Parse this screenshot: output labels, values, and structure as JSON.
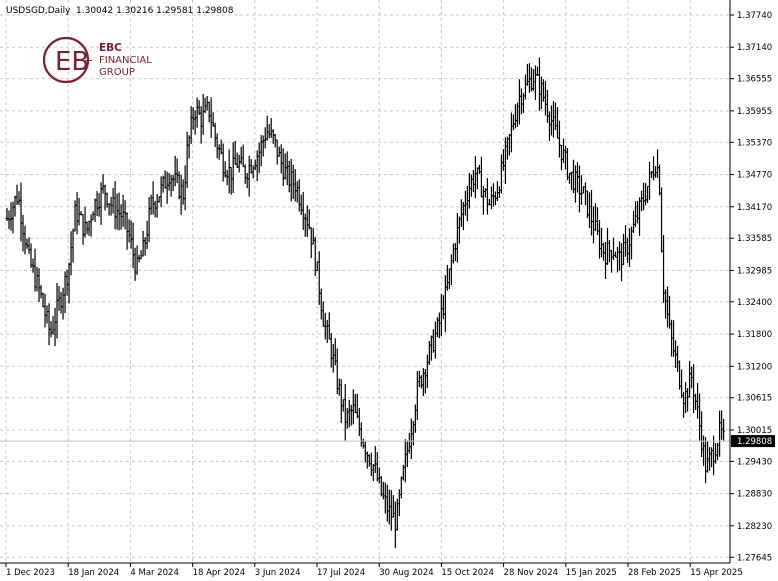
{
  "header": {
    "symbol": "USDSGD,Daily",
    "ohlc": "1.30042 1.30216 1.29581 1.29808"
  },
  "logo": {
    "mark": "EB",
    "line1": "EBC",
    "line2": "FINANCIAL",
    "line3": "GROUP"
  },
  "colors": {
    "bars": "#000000",
    "grid": "#c8c8c8",
    "price_line": "#c0c0c0",
    "price_label_bg": "#000000",
    "price_label_text": "#ffffff",
    "logo": "#7a2230"
  },
  "chart_data": {
    "type": "ohlc",
    "symbol": "USDSGD",
    "timeframe": "Daily",
    "last_price": "1.29808",
    "ylim": [
      1.2765,
      1.3774
    ],
    "y_ticks": [
      "1.37740",
      "1.37140",
      "1.36555",
      "1.35955",
      "1.35370",
      "1.34770",
      "1.34170",
      "1.33585",
      "1.32985",
      "1.32400",
      "1.31800",
      "1.31200",
      "1.30615",
      "1.30015",
      "1.29430",
      "1.28830",
      "1.28230",
      "1.27645"
    ],
    "x_ticks": [
      "1 Dec 2023",
      "18 Jan 2024",
      "4 Mar 2024",
      "18 Apr 2024",
      "3 Jun 2024",
      "17 Jul 2024",
      "30 Aug 2024",
      "15 Oct 2024",
      "28 Nov 2024",
      "15 Jan 2025",
      "28 Feb 2025",
      "15 Apr 2025"
    ],
    "grid": true,
    "series": [
      {
        "close_path": [
          [
            0,
            1.3395
          ],
          [
            3,
            1.344
          ],
          [
            6,
            1.332
          ],
          [
            9,
            1.326
          ],
          [
            12,
            1.318
          ],
          [
            15,
            1.325
          ],
          [
            17,
            1.33
          ],
          [
            19,
            1.341
          ],
          [
            22,
            1.337
          ],
          [
            24,
            1.342
          ],
          [
            27,
            1.345
          ],
          [
            29,
            1.342
          ],
          [
            32,
            1.34
          ],
          [
            34,
            1.336
          ],
          [
            36,
            1.33
          ],
          [
            38,
            1.334
          ],
          [
            40,
            1.342
          ],
          [
            43,
            1.345
          ],
          [
            45,
            1.348
          ],
          [
            47,
            1.346
          ],
          [
            49,
            1.344
          ],
          [
            50,
            1.352
          ],
          [
            52,
            1.36
          ],
          [
            54,
            1.358
          ],
          [
            56,
            1.36
          ],
          [
            58,
            1.354
          ],
          [
            60,
            1.35
          ],
          [
            62,
            1.348
          ],
          [
            64,
            1.35
          ],
          [
            66,
            1.348
          ],
          [
            68,
            1.35
          ],
          [
            70,
            1.352
          ],
          [
            72,
            1.356
          ],
          [
            74,
            1.354
          ],
          [
            76,
            1.35
          ],
          [
            78,
            1.347
          ],
          [
            80,
            1.346
          ],
          [
            82,
            1.342
          ],
          [
            84,
            1.338
          ],
          [
            86,
            1.33
          ],
          [
            88,
            1.32
          ],
          [
            90,
            1.315
          ],
          [
            92,
            1.308
          ],
          [
            94,
            1.302
          ],
          [
            96,
            1.304
          ],
          [
            98,
            1.3
          ],
          [
            100,
            1.296
          ],
          [
            102,
            1.293
          ],
          [
            104,
            1.288
          ],
          [
            106,
            1.285
          ],
          [
            108,
            1.283
          ],
          [
            110,
            1.292
          ],
          [
            112,
            1.3
          ],
          [
            114,
            1.308
          ],
          [
            116,
            1.312
          ],
          [
            118,
            1.316
          ],
          [
            120,
            1.32
          ],
          [
            122,
            1.326
          ],
          [
            124,
            1.334
          ],
          [
            126,
            1.34
          ],
          [
            128,
            1.345
          ],
          [
            130,
            1.348
          ],
          [
            132,
            1.345
          ],
          [
            134,
            1.342
          ],
          [
            136,
            1.345
          ],
          [
            138,
            1.35
          ],
          [
            140,
            1.356
          ],
          [
            142,
            1.362
          ],
          [
            144,
            1.364
          ],
          [
            146,
            1.366
          ],
          [
            148,
            1.364
          ],
          [
            150,
            1.36
          ],
          [
            152,
            1.356
          ],
          [
            154,
            1.352
          ],
          [
            156,
            1.348
          ],
          [
            158,
            1.346
          ],
          [
            160,
            1.344
          ],
          [
            162,
            1.34
          ],
          [
            164,
            1.336
          ],
          [
            166,
            1.333
          ],
          [
            168,
            1.334
          ],
          [
            170,
            1.332
          ],
          [
            172,
            1.334
          ],
          [
            174,
            1.338
          ],
          [
            176,
            1.342
          ],
          [
            178,
            1.346
          ],
          [
            180,
            1.35
          ],
          [
            181,
            1.348
          ],
          [
            182,
            1.328
          ],
          [
            184,
            1.318
          ],
          [
            186,
            1.312
          ],
          [
            188,
            1.306
          ],
          [
            190,
            1.31
          ],
          [
            192,
            1.302
          ],
          [
            194,
            1.293
          ],
          [
            196,
            1.296
          ],
          [
            198,
            1.3
          ],
          [
            199,
            1.298
          ]
        ]
      }
    ]
  }
}
